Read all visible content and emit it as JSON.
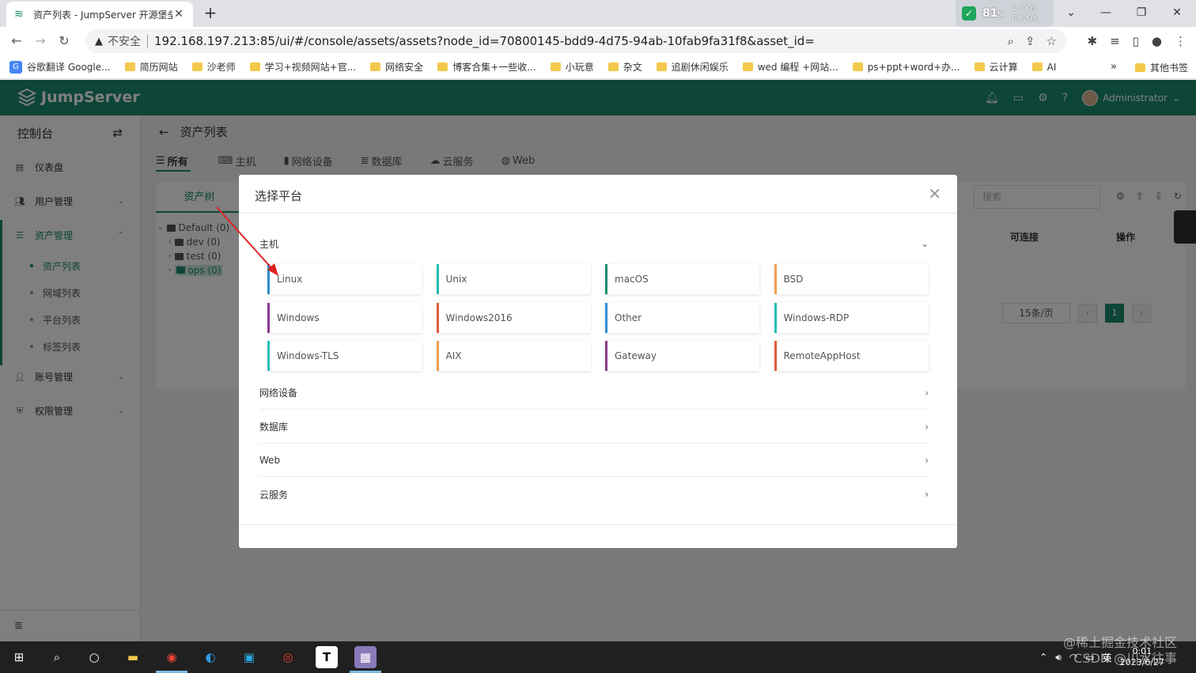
{
  "browser": {
    "tab_title": "资产列表 - JumpServer 开源堡垒",
    "tab_close": "✕",
    "new_tab": "+",
    "net_percent": "81",
    "net_percent_unit": "%",
    "net_up": "1.9",
    "net_up_unit": "K/s",
    "net_down": "0.6",
    "net_down_unit": "K/s",
    "insecure_label": "不安全",
    "url": "192.168.197.213:85/ui/#/console/assets/assets?node_id=70800145-bdd9-4d75-94ab-10fab9fa31f8&asset_id=",
    "bookmarks": [
      "谷歌翻译 Google...",
      "简历网站",
      "沙老师",
      "学习+视频网站+官...",
      "网络安全",
      "博客合集+一些收...",
      "小玩意",
      "杂文",
      "追剧休闲娱乐",
      "wed 编程 +网站...",
      "ps+ppt+word+办...",
      "云计算",
      "AI"
    ],
    "bookmarks_more": "»",
    "other_bookmarks": "其他书签"
  },
  "app": {
    "logo_text": "JumpServer",
    "admin_name": "Administrator",
    "sidebar": {
      "title": "控制台",
      "items": [
        {
          "label": "仪表盘"
        },
        {
          "label": "用户管理"
        },
        {
          "label": "资产管理"
        },
        {
          "label": "账号管理"
        },
        {
          "label": "权限管理"
        }
      ],
      "sub_items": [
        "资产列表",
        "网域列表",
        "平台列表",
        "标签列表"
      ]
    },
    "page_title": "资产列表",
    "type_tabs": [
      "所有",
      "主机",
      "网络设备",
      "数据库",
      "云服务",
      "Web"
    ],
    "tree_tab": "资产树",
    "tree": {
      "root": "Default (0)",
      "children": [
        "dev (0)",
        "test (0)",
        "ops (0)"
      ]
    },
    "search_placeholder": "搜索",
    "col_connectable": "可连接",
    "col_actions": "操作",
    "page_size": "15条/页",
    "current_page": "1"
  },
  "dialog": {
    "title": "选择平台",
    "categories": [
      "主机",
      "网络设备",
      "数据库",
      "Web",
      "云服务"
    ],
    "platforms": [
      {
        "label": "Linux",
        "color": "#2f8fd1"
      },
      {
        "label": "Unix",
        "color": "#26bfb5"
      },
      {
        "label": "macOS",
        "color": "#1a8b6e"
      },
      {
        "label": "BSD",
        "color": "#f0a050"
      },
      {
        "label": "Windows",
        "color": "#8b3a8f"
      },
      {
        "label": "Windows2016",
        "color": "#e35d3c"
      },
      {
        "label": "Other",
        "color": "#2f8fd1"
      },
      {
        "label": "Windows-RDP",
        "color": "#26bfb5"
      },
      {
        "label": "Windows-TLS",
        "color": "#26bfb5"
      },
      {
        "label": "AIX",
        "color": "#f0a050"
      },
      {
        "label": "Gateway",
        "color": "#8b3a8f"
      },
      {
        "label": "RemoteAppHost",
        "color": "#e35d3c"
      }
    ]
  },
  "taskbar": {
    "clock_time": "0:01",
    "clock_date": "2023/6/27",
    "ime": "英"
  },
  "watermark": {
    "line1": "@稀土掘金技术社区",
    "line2": "CSDN @川水往事"
  }
}
